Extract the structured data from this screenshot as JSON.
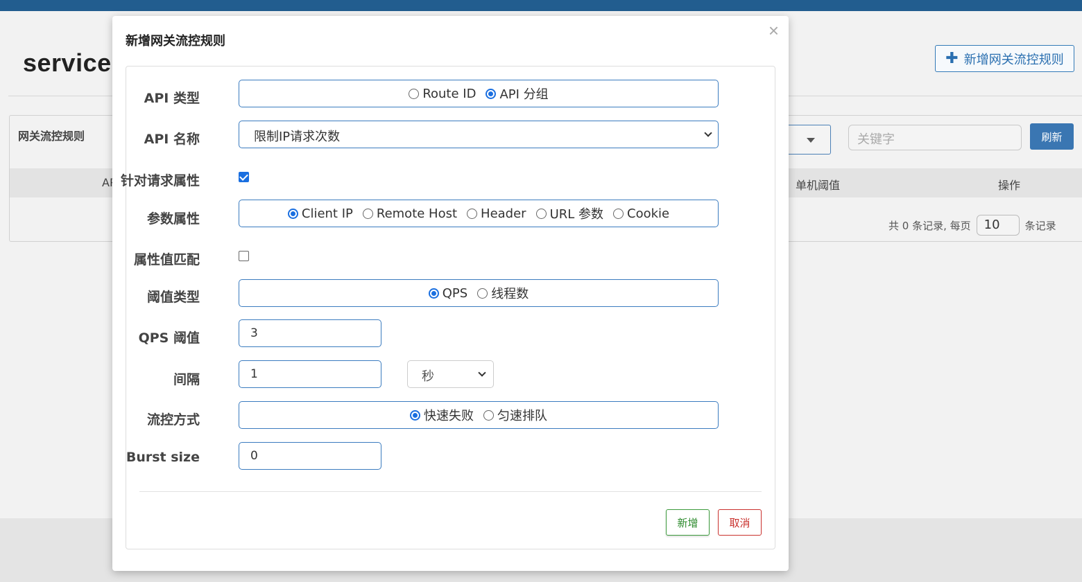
{
  "background": {
    "page_title": "service",
    "add_rule_button": "新增网关流控规则",
    "panel_title": "网关流控规则",
    "search_placeholder": "关键字",
    "refresh_button": "刷新",
    "table_headers": [
      "AP",
      "单机阈值",
      "操作"
    ],
    "pager": {
      "prefix": "共 0 条记录, 每页",
      "page_size": "10",
      "suffix": "条记录"
    }
  },
  "modal": {
    "title": "新增网关流控规则",
    "close": "×",
    "api_type": {
      "label": "API 类型",
      "options": [
        "Route ID",
        "API 分组"
      ],
      "selected": "API 分组"
    },
    "api_name": {
      "label": "API 名称",
      "value": "限制IP请求次数"
    },
    "request_attr": {
      "label": "针对请求属性",
      "checked": true
    },
    "param_attr": {
      "label": "参数属性",
      "options": [
        "Client IP",
        "Remote Host",
        "Header",
        "URL 参数",
        "Cookie"
      ],
      "selected": "Client IP"
    },
    "attr_match": {
      "label": "属性值匹配",
      "checked": false
    },
    "threshold_type": {
      "label": "阈值类型",
      "options": [
        "QPS",
        "线程数"
      ],
      "selected": "QPS"
    },
    "qps_threshold": {
      "label": "QPS 阈值",
      "value": "3"
    },
    "interval": {
      "label": "间隔",
      "value": "1",
      "unit": "秒"
    },
    "control_behavior": {
      "label": "流控方式",
      "options": [
        "快速失败",
        "匀速排队"
      ],
      "selected": "快速失败"
    },
    "burst_size": {
      "label": "Burst size",
      "value": "0"
    },
    "buttons": {
      "add": "新增",
      "cancel": "取消"
    }
  },
  "colors": {
    "top_bar": "#225d8f",
    "primary_blue": "#3a7bbf",
    "radio_blue": "#1a6fe0",
    "success_green": "#2e8b2e",
    "danger_red": "#c9302c"
  },
  "icons": {
    "close": "close-icon",
    "plus": "plus-icon",
    "dropdown": "chevron-down-icon"
  }
}
